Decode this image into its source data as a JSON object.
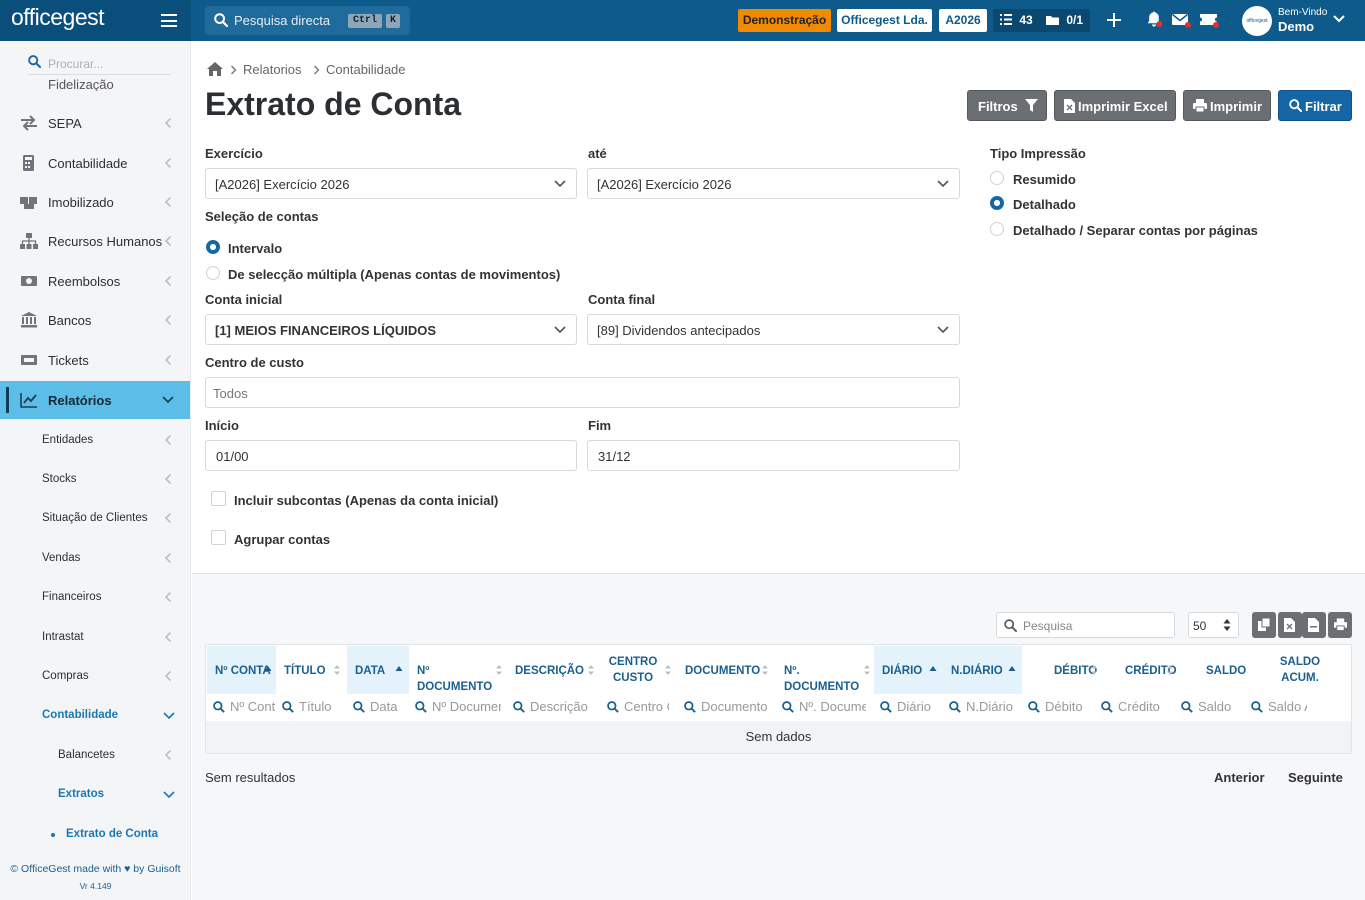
{
  "topbar": {
    "logo": "officegest",
    "search_placeholder": "Pesquisa directa",
    "kbd1": "Ctrl",
    "kbd2": "K",
    "tag_demo": "Demonstração",
    "tag_company": "Officegest Lda.",
    "tag_year": "A2026",
    "tasks_count": "43",
    "docs_count": "0/1",
    "welcome": "Bem-Vindo",
    "user": "Demo",
    "avatar_text": "officegest"
  },
  "sidebar": {
    "search_placeholder": "Procurar...",
    "partial_item": "Fidelização",
    "items": [
      {
        "label": "SEPA",
        "icon": "swap-icon"
      },
      {
        "label": "Contabilidade",
        "icon": "calculator-icon"
      },
      {
        "label": "Imobilizado",
        "icon": "boxes-icon"
      },
      {
        "label": "Recursos Humanos",
        "icon": "org-chart-icon"
      },
      {
        "label": "Reembolsos",
        "icon": "money-icon"
      },
      {
        "label": "Bancos",
        "icon": "bank-icon"
      },
      {
        "label": "Tickets",
        "icon": "ticket-icon"
      },
      {
        "label": "Relatórios",
        "icon": "chart-icon"
      }
    ],
    "sub": [
      "Entidades",
      "Stocks",
      "Situação de Clientes",
      "Vendas",
      "Financeiros",
      "Intrastat",
      "Compras"
    ],
    "sub_contab": "Contabilidade",
    "sub_balancetes": "Balancetes",
    "sub_extratos": "Extratos",
    "sub_extrato_conta": "Extrato de Conta",
    "footer": "© OfficeGest made with ♥ by Guisoft",
    "version": "Vr 4.149"
  },
  "breadcrumb": [
    "Relatorios",
    "Contabilidade"
  ],
  "page_title": "Extrato de Conta",
  "buttons": {
    "filters": "Filtros",
    "excel": "Imprimir Excel",
    "print": "Imprimir",
    "filter": "Filtrar"
  },
  "form": {
    "exercicio_label": "Exercício",
    "exercicio_value": "[A2026] Exercício 2026",
    "ate_label": "até",
    "ate_value": "[A2026] Exercício 2026",
    "selecao_label": "Seleção de contas",
    "radio_intervalo": "Intervalo",
    "radio_multipla": "De selecção múltipla (Apenas contas de movimentos)",
    "conta_inicial_label": "Conta inicial",
    "conta_inicial_value": "[1] MEIOS FINANCEIROS LÍQUIDOS",
    "conta_final_label": "Conta final",
    "conta_final_value": "[89] Dividendos antecipados",
    "centro_label": "Centro de custo",
    "centro_placeholder": "Todos",
    "inicio_label": "Início",
    "inicio_value": "01/00",
    "fim_label": "Fim",
    "fim_value": "31/12",
    "check_subcontas": "Incluir subcontas (Apenas da conta inicial)",
    "check_agrupar": "Agrupar contas",
    "tipo_label": "Tipo Impressão",
    "tipo_resumido": "Resumido",
    "tipo_detalhado": "Detalhado",
    "tipo_separar": "Detalhado / Separar contas por páginas"
  },
  "table": {
    "search_placeholder": "Pesquisa",
    "page_size": "50",
    "columns": [
      {
        "label": "Nº CONTA",
        "filter": "Nº Conta"
      },
      {
        "label": "TÍTULO",
        "filter": "Título"
      },
      {
        "label": "DATA",
        "filter": "Data"
      },
      {
        "label": "Nº DOCUMENTO",
        "filter": "Nº Documento"
      },
      {
        "label": "DESCRIÇÃO",
        "filter": "Descrição"
      },
      {
        "label": "CENTRO CUSTO",
        "filter": "Centro Custo"
      },
      {
        "label": "DOCUMENTO",
        "filter": "Documento"
      },
      {
        "label": "Nº. DOCUMENTO",
        "filter": "Nº. Documento"
      },
      {
        "label": "DIÁRIO",
        "filter": "Diário"
      },
      {
        "label": "N.DIÁRIO",
        "filter": "N.Diário"
      },
      {
        "label": "DÉBITO",
        "filter": "Débito"
      },
      {
        "label": "CRÉDITO",
        "filter": "Crédito"
      },
      {
        "label": "SALDO",
        "filter": "Saldo"
      },
      {
        "label": "SALDO ACUM.",
        "filter": "Saldo Acum."
      }
    ],
    "empty": "Sem dados",
    "no_results": "Sem resultados",
    "prev": "Anterior",
    "next": "Seguinte"
  },
  "colors": {
    "topbar": "#0e5a8a",
    "accent": "#1566a6",
    "active_menu": "#5bbde8",
    "demo_tag": "#f08a00"
  }
}
